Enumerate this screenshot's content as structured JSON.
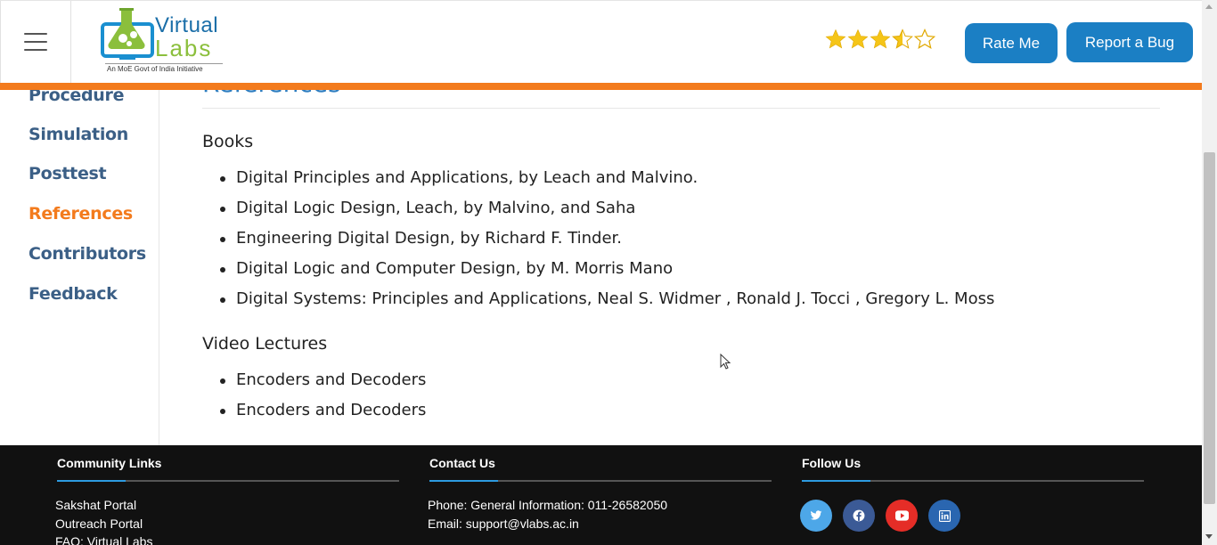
{
  "header": {
    "logo_top": "Virtual",
    "logo_bottom": "Labs",
    "logo_tagline": "An MoE Govt of India Initiative",
    "rating": 3.5,
    "rating_max": 5,
    "rate_button": "Rate Me",
    "bug_button": "Report a Bug",
    "accent_color": "#1b7fc4",
    "bar_color": "#f37b1d"
  },
  "sidebar": {
    "items": [
      {
        "label": "Procedure",
        "active": false
      },
      {
        "label": "Simulation",
        "active": false
      },
      {
        "label": "Posttest",
        "active": false
      },
      {
        "label": "References",
        "active": true
      },
      {
        "label": "Contributors",
        "active": false
      },
      {
        "label": "Feedback",
        "active": false
      }
    ]
  },
  "main": {
    "title": "References",
    "books_heading": "Books",
    "books": [
      "Digital Principles and Applications, by Leach and Malvino.",
      "Digital Logic Design, Leach, by Malvino, and Saha",
      "Engineering Digital Design, by Richard F. Tinder.",
      "Digital Logic and Computer Design, by M. Morris Mano",
      "Digital Systems: Principles and Applications, Neal S. Widmer , Ronald J. Tocci , Gregory L. Moss"
    ],
    "video_heading": "Video Lectures",
    "videos": [
      "Encoders and Decoders",
      "Encoders and Decoders"
    ]
  },
  "footer": {
    "community": {
      "heading": "Community Links",
      "links": [
        "Sakshat Portal",
        "Outreach Portal",
        "FAQ: Virtual Labs"
      ]
    },
    "contact": {
      "heading": "Contact Us",
      "phone": "Phone: General Information: 011-26582050",
      "email": "Email: support@vlabs.ac.in"
    },
    "follow": {
      "heading": "Follow Us",
      "icons": [
        {
          "name": "twitter-icon",
          "color": "#4da7e8"
        },
        {
          "name": "facebook-icon",
          "color": "#3b5a96"
        },
        {
          "name": "youtube-icon",
          "color": "#e52d27"
        },
        {
          "name": "linkedin-icon",
          "color": "#2a66b0"
        }
      ]
    }
  }
}
